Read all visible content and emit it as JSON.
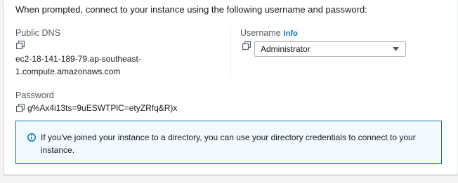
{
  "intro_text": "When prompted, connect to your instance using the following username and password:",
  "public_dns": {
    "label": "Public DNS",
    "value_line1": "ec2-18-141-189-79.ap-southeast-",
    "value_line2": "1.compute.amazonaws.com"
  },
  "username": {
    "label": "Username",
    "info_link": "Info",
    "selected": "Administrator"
  },
  "password": {
    "label": "Password",
    "value": "g%Ax4i13ts=9uESWTPlC=etyZRfq&R)x"
  },
  "alert": {
    "message": "If you've joined your instance to a directory, you can use your directory credentials to connect to your instance."
  },
  "icons": {
    "copy": "copy-icon",
    "caret": "caret-down-icon",
    "info": "info-circle-icon"
  },
  "colors": {
    "link": "#0073bb",
    "alert_border": "#0073bb",
    "alert_bg": "#f1faff",
    "text": "#16191f",
    "label": "#545b64"
  }
}
